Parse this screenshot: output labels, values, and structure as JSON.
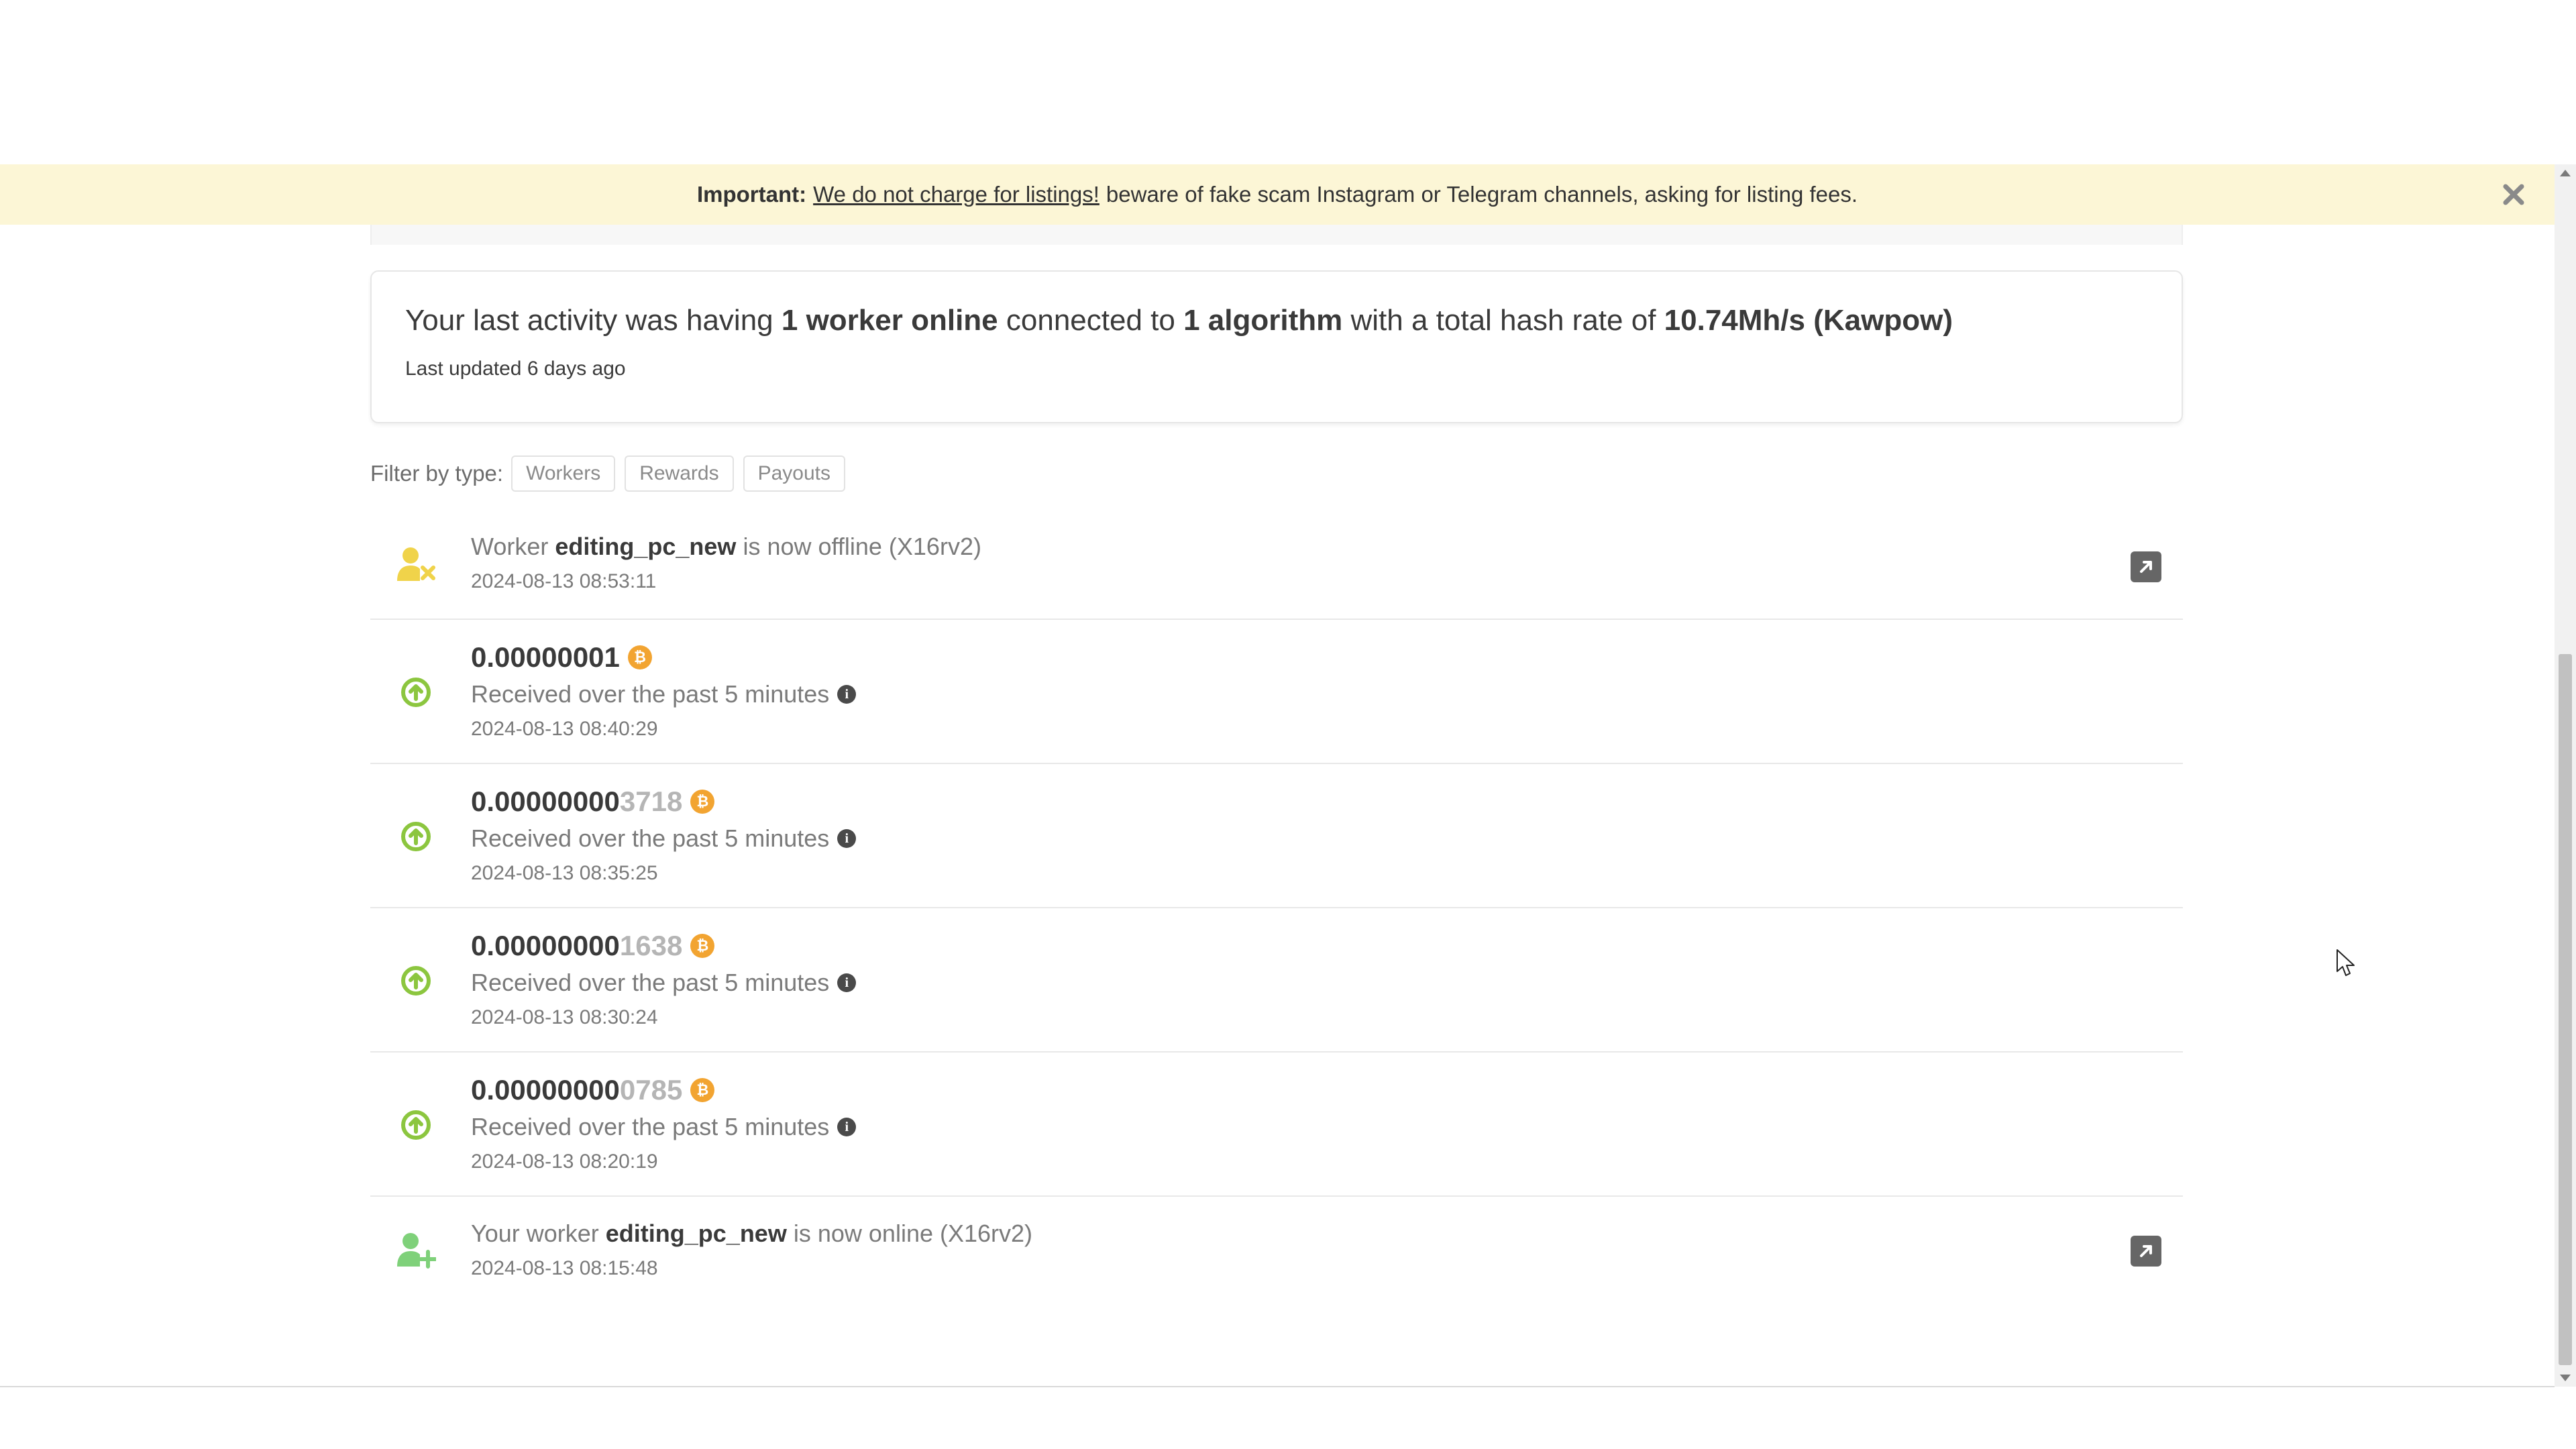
{
  "banner": {
    "important": "Important:",
    "link": "We do not charge for listings!",
    "rest": "beware of fake scam Instagram or Telegram channels, asking for listing fees."
  },
  "activity": {
    "p1": "Your last activity was having",
    "workers": "1 worker online",
    "p2": "connected to",
    "algos": "1 algorithm",
    "p3": "with a total hash rate of",
    "hashrate": "10.74Mh/s (Kawpow)",
    "updated": "Last updated 6 days ago"
  },
  "filter": {
    "label": "Filter by type:",
    "options": [
      "Workers",
      "Rewards",
      "Payouts"
    ]
  },
  "feed": {
    "offline": {
      "prefix": "Worker",
      "worker": "editing_pc_new",
      "suffix": "is now offline (X16rv2)",
      "date": "2024-08-13 08:53:11"
    },
    "rewards": [
      {
        "amount": "0.00000001",
        "amount_faded": "",
        "desc": "Received over the past 5 minutes",
        "date": "2024-08-13 08:40:29"
      },
      {
        "amount": "0.00000000",
        "amount_faded": "3718",
        "desc": "Received over the past 5 minutes",
        "date": "2024-08-13 08:35:25"
      },
      {
        "amount": "0.00000000",
        "amount_faded": "1638",
        "desc": "Received over the past 5 minutes",
        "date": "2024-08-13 08:30:24"
      },
      {
        "amount": "0.00000000",
        "amount_faded": "0785",
        "desc": "Received over the past 5 minutes",
        "date": "2024-08-13 08:20:19"
      }
    ],
    "online": {
      "prefix": "Your worker",
      "worker": "editing_pc_new",
      "suffix": "is now online (X16rv2)",
      "date": "2024-08-13 08:15:48"
    }
  },
  "colors": {
    "banner_bg": "#fcf6d6",
    "offline_icon": "#f0d34a",
    "reward_icon": "#8cc63f",
    "online_icon": "#7fd17a",
    "btc": "#f2a431"
  },
  "icons": {
    "close": "close-icon",
    "offline": "user-offline-icon",
    "reward": "arrow-up-circle-icon",
    "online": "user-add-icon",
    "external": "external-link-icon",
    "btc": "bitcoin-icon",
    "info": "info-icon"
  }
}
